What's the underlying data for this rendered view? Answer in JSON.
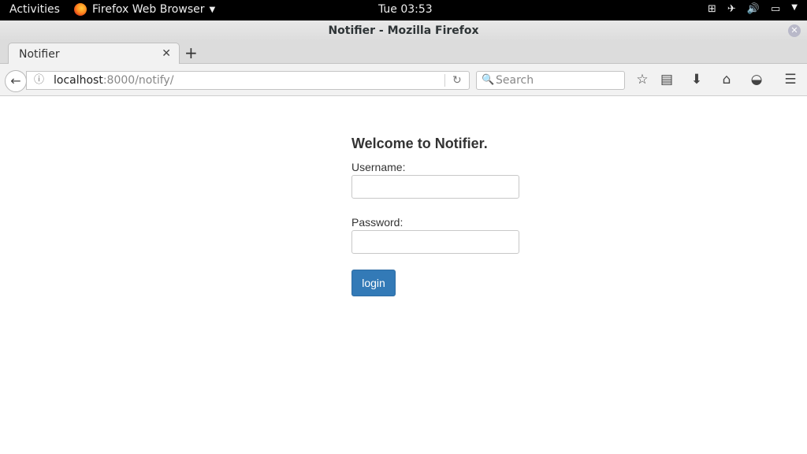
{
  "system_bar": {
    "activities": "Activities",
    "app_name": "Firefox Web Browser",
    "clock": "Tue 03:53"
  },
  "window": {
    "title": "Notifier - Mozilla Firefox"
  },
  "tabs": [
    {
      "label": "Notifier"
    }
  ],
  "nav": {
    "url_host": "localhost",
    "url_rest": ":8000/notify/",
    "search_placeholder": "Search"
  },
  "page": {
    "welcome": "Welcome to Notifier.",
    "username_label": "Username:",
    "username_value": "",
    "password_label": "Password:",
    "password_value": "",
    "login_label": "login"
  },
  "colors": {
    "primary_button": "#337ab7"
  }
}
